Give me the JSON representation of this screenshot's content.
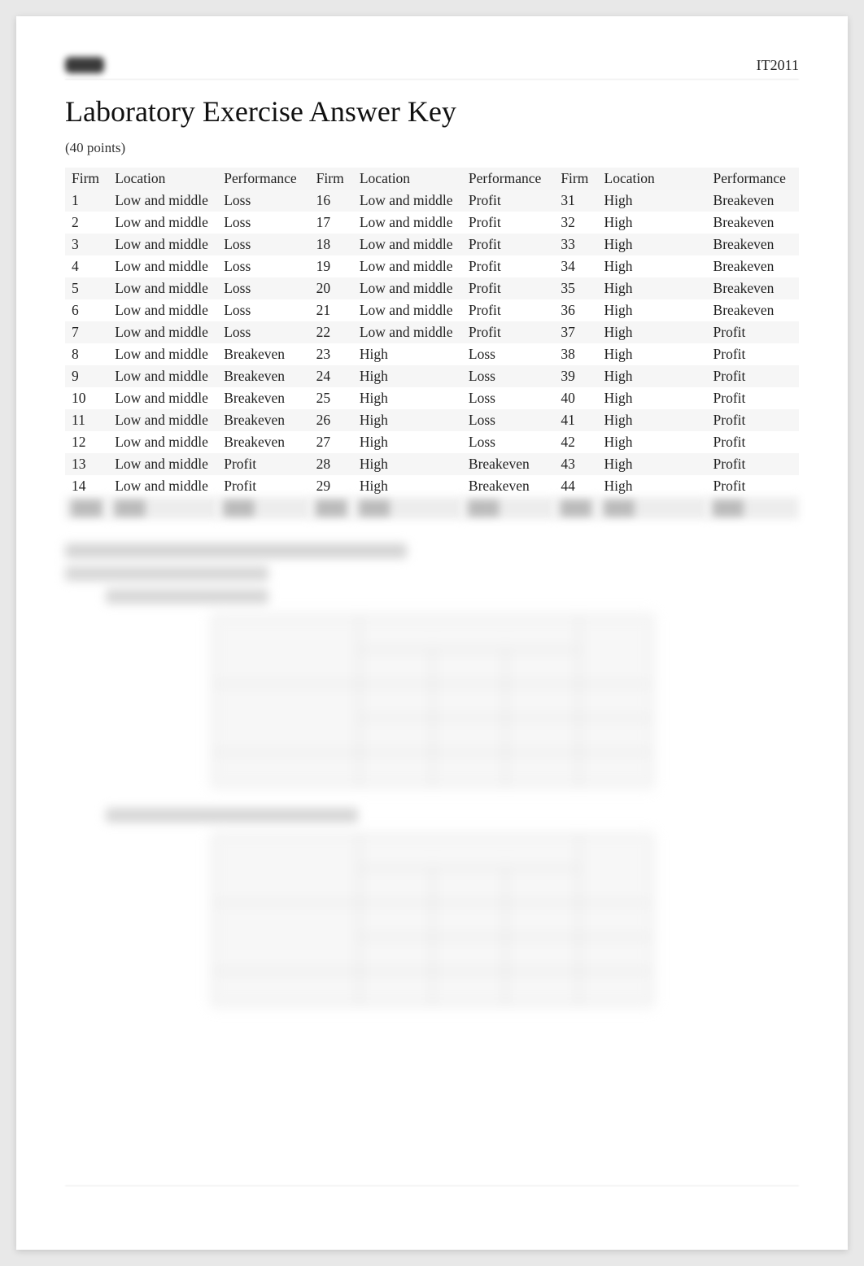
{
  "header": {
    "course_code": "IT2011"
  },
  "title": "Laboratory Exercise Answer Key",
  "points_label": "(40 points)",
  "columns": [
    "Firm",
    "Location",
    "Performance"
  ],
  "rows": [
    {
      "firm": "1",
      "location": "Low and middle",
      "performance": "Loss"
    },
    {
      "firm": "2",
      "location": "Low and middle",
      "performance": "Loss"
    },
    {
      "firm": "3",
      "location": "Low and middle",
      "performance": "Loss"
    },
    {
      "firm": "4",
      "location": "Low and middle",
      "performance": "Loss"
    },
    {
      "firm": "5",
      "location": "Low and middle",
      "performance": "Loss"
    },
    {
      "firm": "6",
      "location": "Low and middle",
      "performance": "Loss"
    },
    {
      "firm": "7",
      "location": "Low and middle",
      "performance": "Loss"
    },
    {
      "firm": "8",
      "location": "Low and middle",
      "performance": "Breakeven"
    },
    {
      "firm": "9",
      "location": "Low and middle",
      "performance": "Breakeven"
    },
    {
      "firm": "10",
      "location": "Low and middle",
      "performance": "Breakeven"
    },
    {
      "firm": "11",
      "location": "Low and middle",
      "performance": "Breakeven"
    },
    {
      "firm": "12",
      "location": "Low and middle",
      "performance": "Breakeven"
    },
    {
      "firm": "13",
      "location": "Low and middle",
      "performance": "Profit"
    },
    {
      "firm": "14",
      "location": "Low and middle",
      "performance": "Profit"
    },
    {
      "firm": "16",
      "location": "Low and middle",
      "performance": "Profit"
    },
    {
      "firm": "17",
      "location": "Low and middle",
      "performance": "Profit"
    },
    {
      "firm": "18",
      "location": "Low and middle",
      "performance": "Profit"
    },
    {
      "firm": "19",
      "location": "Low and middle",
      "performance": "Profit"
    },
    {
      "firm": "20",
      "location": "Low and middle",
      "performance": "Profit"
    },
    {
      "firm": "21",
      "location": "Low and middle",
      "performance": "Profit"
    },
    {
      "firm": "22",
      "location": "Low and middle",
      "performance": "Profit"
    },
    {
      "firm": "23",
      "location": "High",
      "performance": "Loss"
    },
    {
      "firm": "24",
      "location": "High",
      "performance": "Loss"
    },
    {
      "firm": "25",
      "location": "High",
      "performance": "Loss"
    },
    {
      "firm": "26",
      "location": "High",
      "performance": "Loss"
    },
    {
      "firm": "27",
      "location": "High",
      "performance": "Loss"
    },
    {
      "firm": "28",
      "location": "High",
      "performance": "Breakeven"
    },
    {
      "firm": "29",
      "location": "High",
      "performance": "Breakeven"
    },
    {
      "firm": "31",
      "location": "High",
      "performance": "Breakeven"
    },
    {
      "firm": "32",
      "location": "High",
      "performance": "Breakeven"
    },
    {
      "firm": "33",
      "location": "High",
      "performance": "Breakeven"
    },
    {
      "firm": "34",
      "location": "High",
      "performance": "Breakeven"
    },
    {
      "firm": "35",
      "location": "High",
      "performance": "Breakeven"
    },
    {
      "firm": "36",
      "location": "High",
      "performance": "Breakeven"
    },
    {
      "firm": "37",
      "location": "High",
      "performance": "Profit"
    },
    {
      "firm": "38",
      "location": "High",
      "performance": "Profit"
    },
    {
      "firm": "39",
      "location": "High",
      "performance": "Profit"
    },
    {
      "firm": "40",
      "location": "High",
      "performance": "Profit"
    },
    {
      "firm": "41",
      "location": "High",
      "performance": "Profit"
    },
    {
      "firm": "42",
      "location": "High",
      "performance": "Profit"
    },
    {
      "firm": "43",
      "location": "High",
      "performance": "Profit"
    },
    {
      "firm": "44",
      "location": "High",
      "performance": "Profit"
    }
  ],
  "display_rows_per_block": 14,
  "blocks": 3
}
